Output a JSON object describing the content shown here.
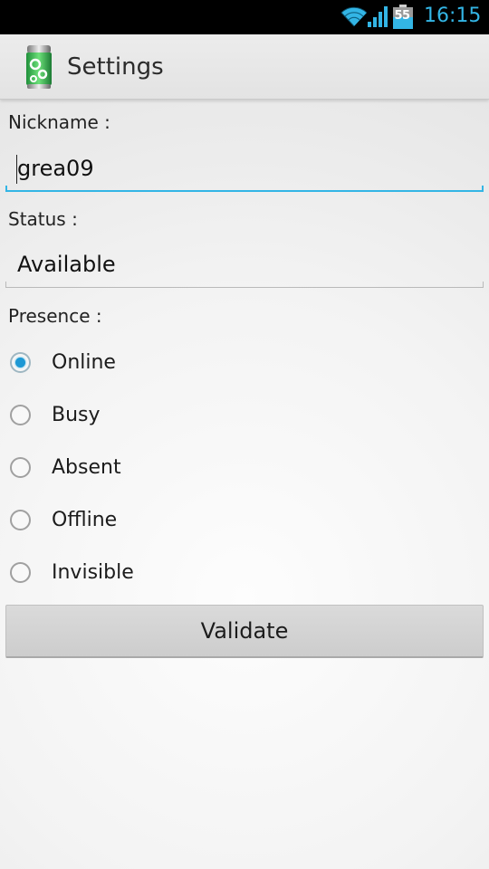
{
  "status_bar": {
    "battery_level": "55",
    "time": "16:15",
    "icons": [
      "wifi-icon",
      "signal-icon",
      "battery-icon"
    ],
    "accent_color": "#33b5e5"
  },
  "action_bar": {
    "title": "Settings",
    "icon": "app-battery-icon"
  },
  "form": {
    "nickname": {
      "label": "Nickname :",
      "value": "grea09",
      "focused": true
    },
    "status": {
      "label": "Status :",
      "value": "Available"
    },
    "presence": {
      "label": "Presence :",
      "selected": "Online",
      "options": [
        {
          "label": "Online",
          "checked": true
        },
        {
          "label": "Busy",
          "checked": false
        },
        {
          "label": "Absent",
          "checked": false
        },
        {
          "label": "Offline",
          "checked": false
        },
        {
          "label": "Invisible",
          "checked": false
        }
      ]
    },
    "validate_label": "Validate"
  },
  "colors": {
    "focus_accent": "#33b5e5",
    "radio_checked": "#1d98d4",
    "button_bg": "#d4d4d4"
  }
}
